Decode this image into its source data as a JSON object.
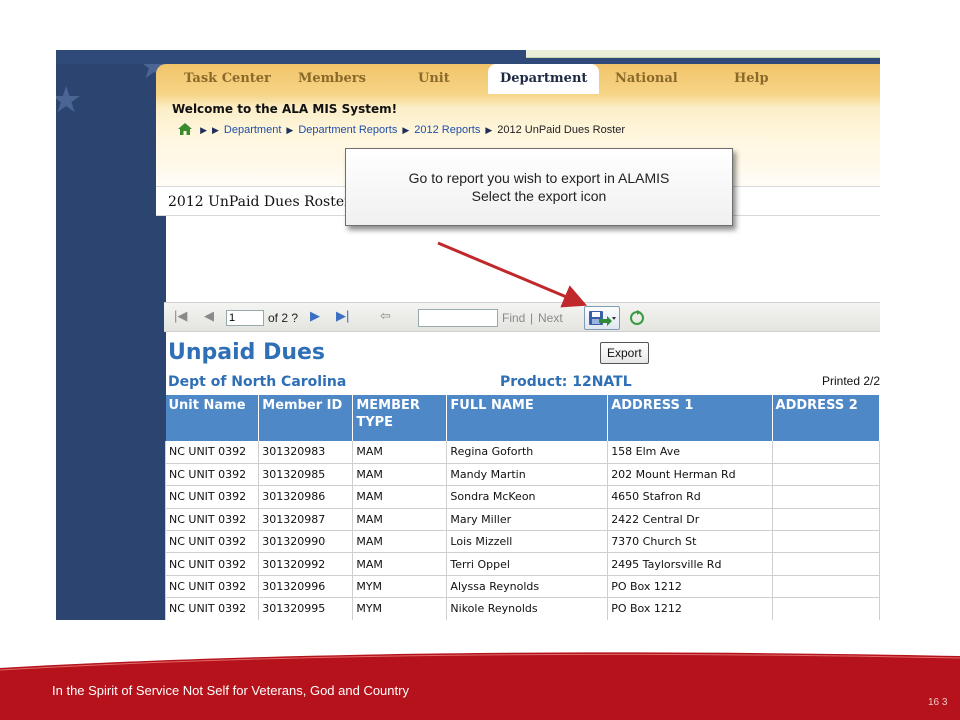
{
  "tabs": [
    "Task Center",
    "Members",
    "Unit",
    "Department",
    "National",
    "Help"
  ],
  "active_tab": "Department",
  "welcome": "Welcome to the ALA MIS System!",
  "breadcrumb": [
    "Department",
    "Department Reports",
    "2012 Reports",
    "2012 UnPaid Dues Roster"
  ],
  "report_header_title": "2012 UnPaid Dues Roster",
  "callout": {
    "line1": "Go to report you wish to export in ALAMIS",
    "line2": "Select the export icon"
  },
  "toolbar": {
    "page_value": "1",
    "page_of": "of 2 ?",
    "find_label": "Find",
    "sep": "|",
    "next_label": "Next",
    "export_tooltip": "Export"
  },
  "report": {
    "title": "Unpaid Dues",
    "dept": "Dept of North Carolina",
    "product": "Product:  12NATL",
    "printed": "Printed 2/2"
  },
  "table": {
    "columns": [
      "Unit Name",
      "Member ID",
      "MEMBER TYPE",
      "FULL NAME",
      "ADDRESS 1",
      "ADDRESS 2"
    ],
    "rows": [
      [
        "NC UNIT 0392",
        "301320983",
        "MAM",
        "Regina Goforth",
        "158 Elm Ave",
        ""
      ],
      [
        "NC UNIT 0392",
        "301320985",
        "MAM",
        "Mandy Martin",
        "202 Mount Herman Rd",
        ""
      ],
      [
        "NC UNIT 0392",
        "301320986",
        "MAM",
        "Sondra McKeon",
        "4650 Stafron Rd",
        ""
      ],
      [
        "NC UNIT 0392",
        "301320987",
        "MAM",
        "Mary Miller",
        "2422 Central Dr",
        ""
      ],
      [
        "NC UNIT 0392",
        "301320990",
        "MAM",
        "Lois Mizzell",
        "7370 Church St",
        ""
      ],
      [
        "NC UNIT 0392",
        "301320992",
        "MAM",
        "Terri Oppel",
        "2495 Taylorsville Rd",
        ""
      ],
      [
        "NC UNIT 0392",
        "301320996",
        "MYM",
        "Alyssa Reynolds",
        "PO Box 1212",
        ""
      ],
      [
        "NC UNIT 0392",
        "301320995",
        "MYM",
        "Nikole Reynolds",
        "PO Box 1212",
        ""
      ]
    ]
  },
  "footer": {
    "text": "In the Spirit of Service Not Self  for Veterans, God and Country",
    "slide_number": "16 3"
  },
  "colors": {
    "accent_blue": "#2e6fb5",
    "header_blue": "#4f88c6",
    "footer_red": "#b5121b",
    "arrow_red": "#c0282b"
  }
}
